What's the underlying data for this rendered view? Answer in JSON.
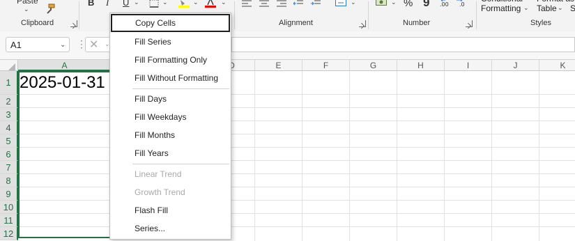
{
  "ribbon": {
    "paste_label": "Paste",
    "groups": {
      "clipboard": "Clipboard",
      "alignment": "Alignment",
      "number": "Number",
      "styles": "Styles"
    },
    "font_buttons": {
      "bold": "B",
      "italic": "I",
      "underline": "U"
    },
    "number_buttons": {
      "percent": "%",
      "comma": "9"
    },
    "styles": {
      "conditional_formatting": "Formatting",
      "format_as_table": "Table",
      "cell_styles": "S"
    },
    "colors": {
      "highlight": "#ffff00",
      "font_color": "#ff0000",
      "accent": "#217346"
    }
  },
  "formula_bar": {
    "name_box": "A1",
    "formula_value": ""
  },
  "grid": {
    "columns": [
      "A",
      "D",
      "E",
      "F",
      "G",
      "H",
      "I",
      "J",
      "K"
    ],
    "rows": [
      "1",
      "2",
      "3",
      "4",
      "5",
      "6",
      "7",
      "8",
      "9",
      "10",
      "11",
      "12"
    ],
    "cell_a1": "2025-01-31"
  },
  "context_menu": {
    "items": [
      {
        "label": "Copy Cells",
        "enabled": true,
        "focused": true
      },
      {
        "label": "Fill Series",
        "enabled": true
      },
      {
        "label": "Fill Formatting Only",
        "enabled": true
      },
      {
        "label": "Fill Without Formatting",
        "enabled": true
      },
      {
        "label": "Fill Days",
        "enabled": true
      },
      {
        "label": "Fill Weekdays",
        "enabled": true
      },
      {
        "label": "Fill Months",
        "enabled": true
      },
      {
        "label": "Fill Years",
        "enabled": true
      },
      {
        "label": "Linear Trend",
        "enabled": false
      },
      {
        "label": "Growth Trend",
        "enabled": false
      },
      {
        "label": "Flash Fill",
        "enabled": true
      },
      {
        "label": "Series...",
        "enabled": true
      }
    ]
  }
}
